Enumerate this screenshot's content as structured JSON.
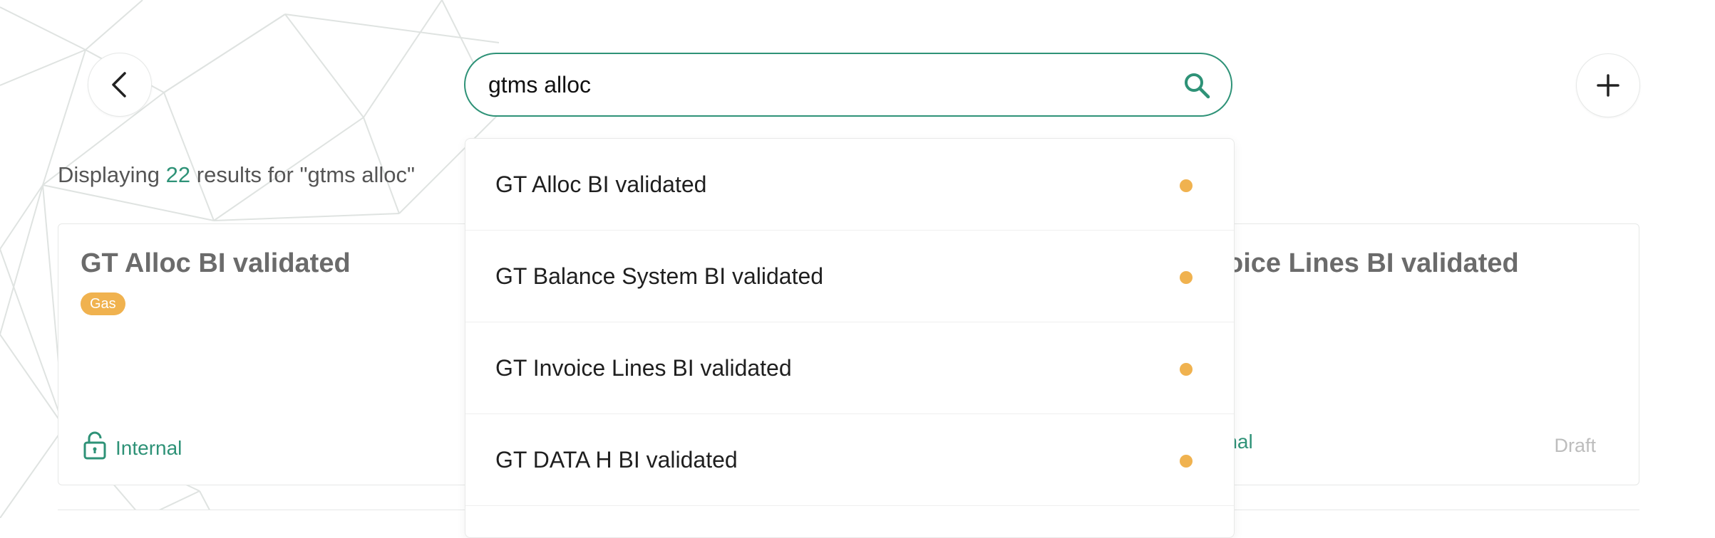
{
  "header": {
    "back_icon": "chevron-left-icon",
    "add_icon": "plus-icon"
  },
  "search": {
    "value": "gtms alloc",
    "placeholder": "",
    "icon": "search-icon"
  },
  "results": {
    "prefix": "Displaying",
    "count": "22",
    "suffix": "results for \"gtms alloc\""
  },
  "cards": [
    {
      "title": "GT Alloc BI validated",
      "tag": "Gas",
      "access": "Internal",
      "access_icon": "unlock-icon"
    },
    {
      "title_visible": "oice Lines BI validated",
      "access_visible": "rnal",
      "status": "Draft"
    }
  ],
  "dropdown": {
    "items": [
      {
        "label": "GT Alloc BI validated"
      },
      {
        "label": "GT Balance System BI validated"
      },
      {
        "label": "GT Invoice Lines BI validated"
      },
      {
        "label": "GT DATA H BI validated"
      }
    ]
  },
  "colors": {
    "accent": "#2e9277",
    "tag": "#f0b24f",
    "status_dot": "#f0b24f",
    "muted_text": "#6b6b6b",
    "border": "#e6e8e7"
  }
}
